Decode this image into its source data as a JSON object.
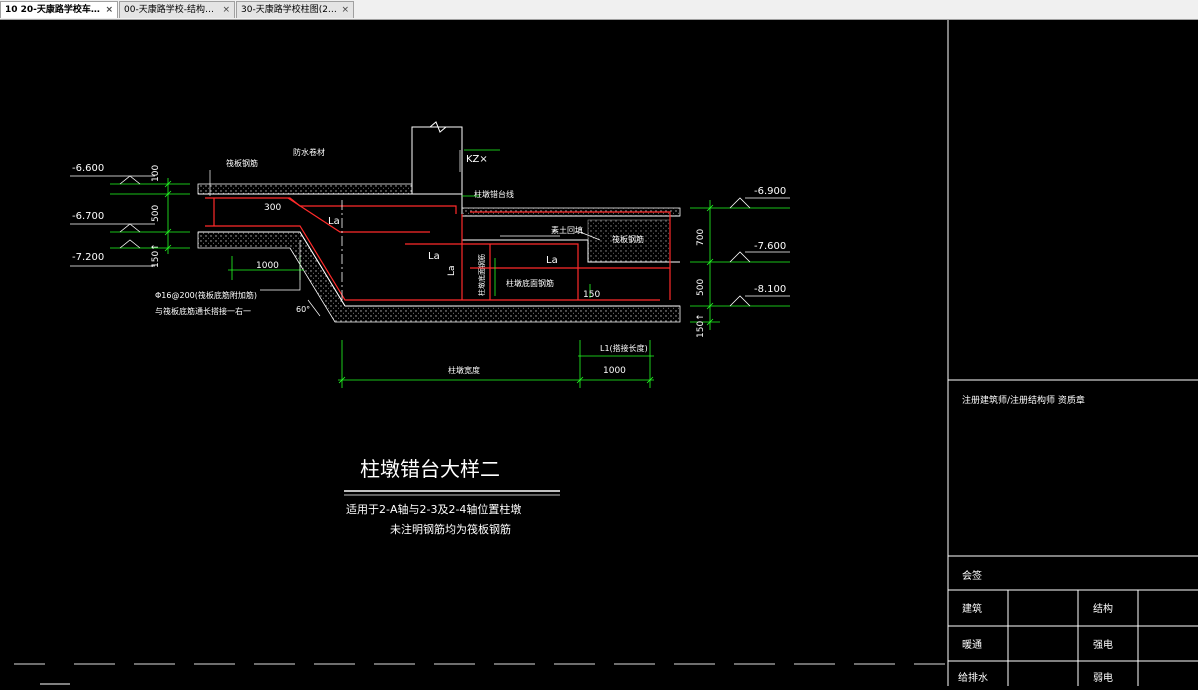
{
  "tabs": [
    {
      "label": "10 20-天康路学校车…",
      "active": true
    },
    {
      "label": "00-天康路学校-结构…",
      "active": false
    },
    {
      "label": "30-天康路学校柱图(2…",
      "active": false
    }
  ],
  "tab_close_glyph": "×",
  "drawing": {
    "title": "柱墩错台大样二",
    "subtitle_1": "适用于2-A轴与2-3及2-4轴位置柱墩",
    "subtitle_2": "未注明钢筋均为筏板钢筋",
    "elev_left": [
      "-6.600",
      "-6.700",
      "-7.200"
    ],
    "elev_right": [
      "-6.900",
      "-7.600",
      "-8.100"
    ],
    "dims_left": [
      "100",
      "500",
      "150↑"
    ],
    "dims_right": [
      "700",
      "500",
      "150↑"
    ],
    "label_waterproof": "防水卷材",
    "label_slab_rebar": "筏板钢筋",
    "label_kz": "KZ×",
    "label_column_edge": "柱墩错台线",
    "label_300": "300",
    "label_la": "La",
    "label_backfill": "素土回填",
    "label_slab_rebar_2": "筏板钢筋",
    "label_1000_a": "1000",
    "label_1000_b": "1000",
    "label_150": "150",
    "label_note_1": "Φ16@200(筏板底筋附加筋)",
    "label_note_2": "与筏板底筋通长搭接一右一",
    "label_vertical": "柱墩底面钢筋",
    "label_bottom_rebar": "柱墩底面钢筋",
    "label_60": "60°",
    "label_width": "柱墩宽度",
    "label_l1": "L1(搭接长度)"
  },
  "title_block": {
    "stamp_label": "注册建筑师/注册结构师    资质章",
    "sign_label": "会签",
    "rows": [
      {
        "left": "建筑",
        "right": "结构"
      },
      {
        "left": "暖通",
        "right": "强电"
      },
      {
        "left": "给排水",
        "right": "弱电"
      }
    ]
  },
  "colors": {
    "line": "#ffffff",
    "rebar": "#ff2a2a",
    "dim": "#22ff22",
    "annot": "#ffffff",
    "elev_dim": "#22ff22"
  }
}
